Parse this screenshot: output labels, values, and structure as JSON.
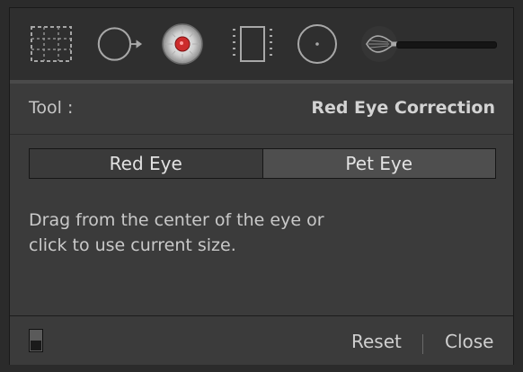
{
  "toolbar": {
    "tools": [
      {
        "icon": "crop-overlay-icon"
      },
      {
        "icon": "spot-removal-icon"
      },
      {
        "icon": "red-eye-icon"
      },
      {
        "icon": "graduated-filter-icon"
      },
      {
        "icon": "radial-filter-icon"
      },
      {
        "icon": "adjustment-brush-icon"
      }
    ],
    "active_tool_color": "#cc2b2b"
  },
  "tool_header": {
    "label": "Tool :",
    "name": "Red Eye Correction"
  },
  "mode": {
    "options": [
      "Red Eye",
      "Pet Eye"
    ],
    "selected": "Red Eye"
  },
  "hint": {
    "line1": "Drag from the center of the eye or",
    "line2": "click to use current size."
  },
  "footer": {
    "reset_label": "Reset",
    "close_label": "Close"
  }
}
